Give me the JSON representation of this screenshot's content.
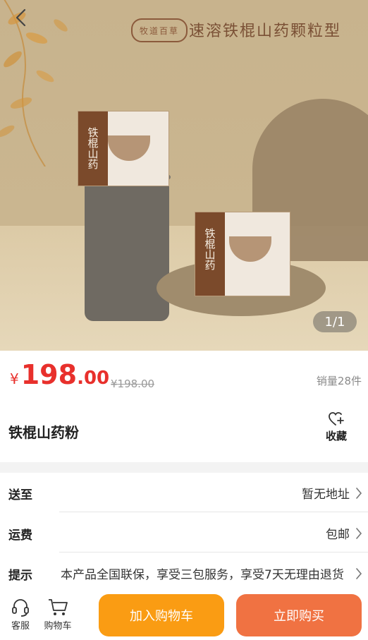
{
  "hero": {
    "seal_text": "牧道百草",
    "title": "速溶铁棍山药颗粒型",
    "box_spine_text": "铁棍山药",
    "counter": "1/1"
  },
  "product": {
    "currency": "¥",
    "price_int": "198",
    "price_dec": ".00",
    "original_price": "¥198.00",
    "sales": "销量28件",
    "name": "铁棍山药粉",
    "favorite_label": "收藏"
  },
  "details": {
    "ship_to_label": "送至",
    "ship_to_value": "暂无地址",
    "freight_label": "运费",
    "freight_value": "包邮",
    "tips_label": "提示",
    "tips_value": "本产品全国联保，享受三包服务，享受7天无理由退货"
  },
  "bottom": {
    "service_label": "客服",
    "cart_label": "购物车",
    "add_cart_label": "加入购物车",
    "buy_now_label": "立即购买"
  },
  "colors": {
    "price_red": "#e8302c",
    "add_cart_orange": "#fa9c13",
    "buy_now_orange": "#f07242"
  }
}
